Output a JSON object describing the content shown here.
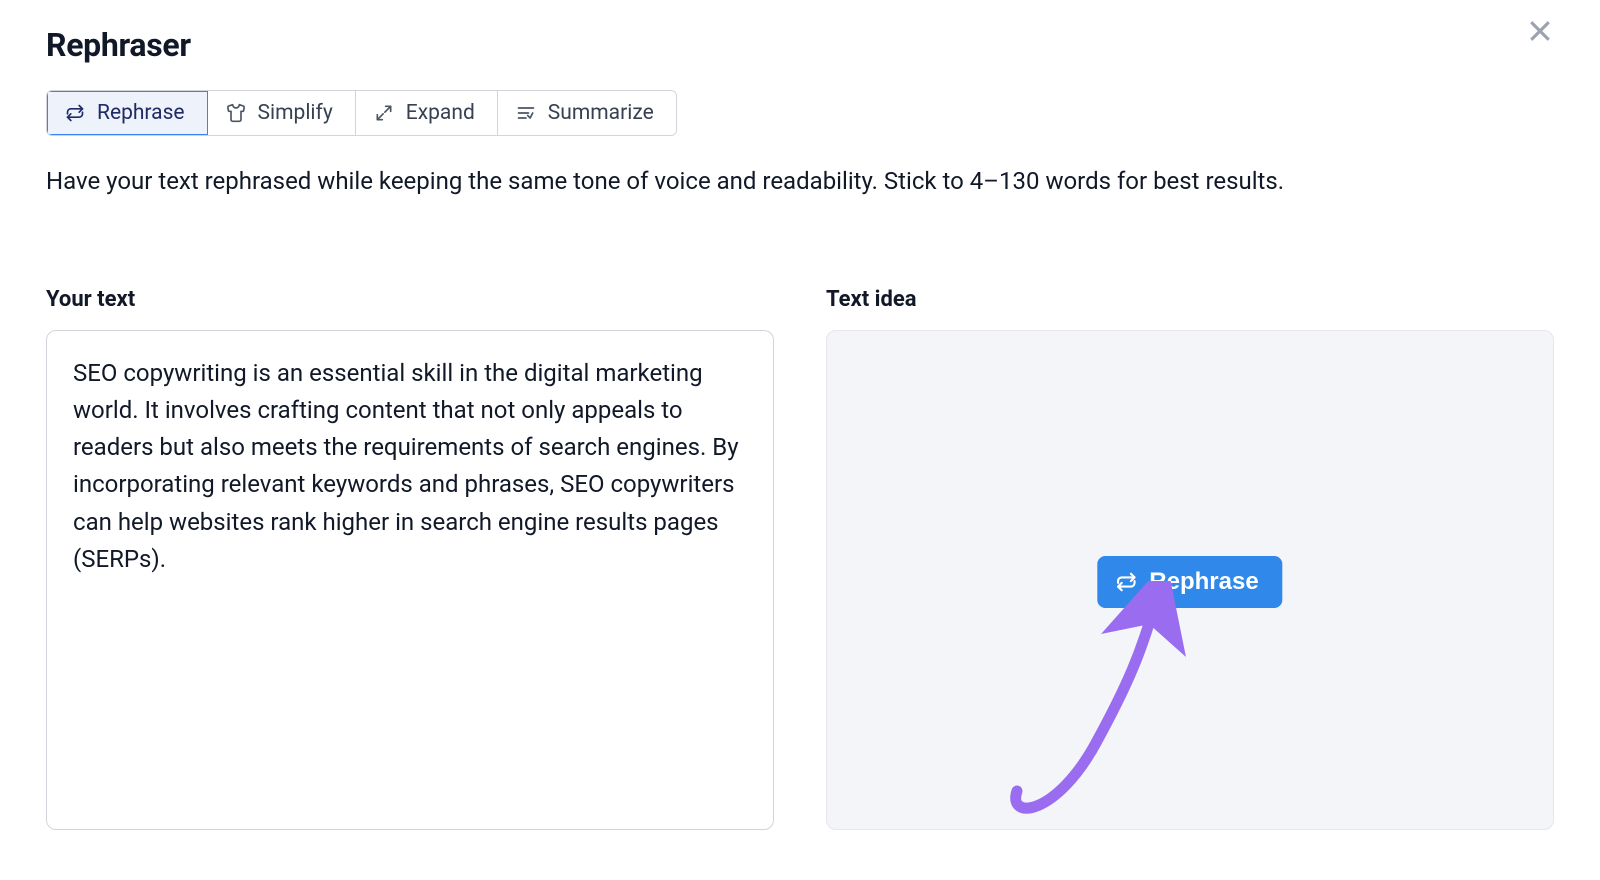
{
  "header": {
    "title": "Rephraser"
  },
  "tabs": [
    {
      "label": "Rephrase",
      "icon": "rephrase-icon",
      "active": true
    },
    {
      "label": "Simplify",
      "icon": "shirt-icon",
      "active": false
    },
    {
      "label": "Expand",
      "icon": "expand-icon",
      "active": false
    },
    {
      "label": "Summarize",
      "icon": "summarize-icon",
      "active": false
    }
  ],
  "description": "Have your text rephrased while keeping the same tone of voice and readability. Stick to 4–130 words for best results.",
  "left": {
    "label": "Your text",
    "value": "SEO copywriting is an essential skill in the digital marketing world. It involves crafting content that not only appeals to readers but also meets the requirements of search engines. By incorporating relevant keywords and phrases, SEO copywriters can help websites rank higher in search engine results pages (SERPs)."
  },
  "right": {
    "label": "Text idea",
    "button_label": "Rephrase"
  },
  "colors": {
    "accent_blue": "#2f88ea",
    "annotation_purple": "#9a6cf0",
    "panel_bg": "#f3f5f9"
  }
}
